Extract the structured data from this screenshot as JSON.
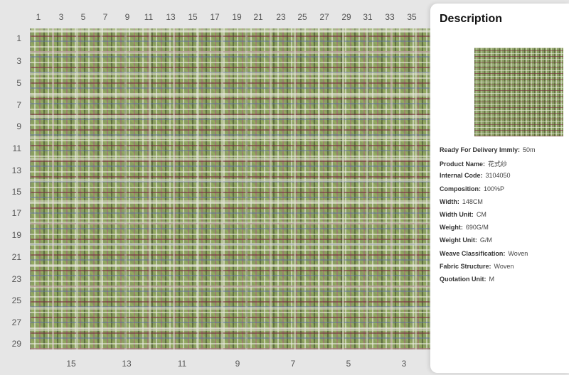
{
  "ruler": {
    "top": [
      "1",
      "3",
      "5",
      "7",
      "9",
      "11",
      "13",
      "15",
      "17",
      "19",
      "21",
      "23",
      "25",
      "27",
      "29",
      "31",
      "33",
      "35"
    ],
    "left": [
      "1",
      "3",
      "5",
      "7",
      "9",
      "11",
      "13",
      "15",
      "17",
      "19",
      "21",
      "23",
      "25",
      "27",
      "29"
    ],
    "bottom": [
      "15",
      "13",
      "11",
      "9",
      "7",
      "5",
      "3"
    ]
  },
  "description": {
    "title": "Description",
    "specs": [
      {
        "label": "Ready For Delivery Immly:",
        "value": "50m"
      },
      {
        "label": "Product Name:",
        "value": "花式纱"
      },
      {
        "label": "Internal Code:",
        "value": "3104050"
      },
      {
        "label": "Composition:",
        "value": "100%P"
      },
      {
        "label": "Width:",
        "value": "148CM"
      },
      {
        "label": "Width Unit:",
        "value": "CM"
      },
      {
        "label": "Weight:",
        "value": "690G/M"
      },
      {
        "label": "Weight Unit:",
        "value": "G/M"
      },
      {
        "label": "Weave Classification:",
        "value": "Woven"
      },
      {
        "label": "Fabric Structure:",
        "value": "Woven"
      },
      {
        "label": "Quotation Unit:",
        "value": "M"
      }
    ]
  }
}
